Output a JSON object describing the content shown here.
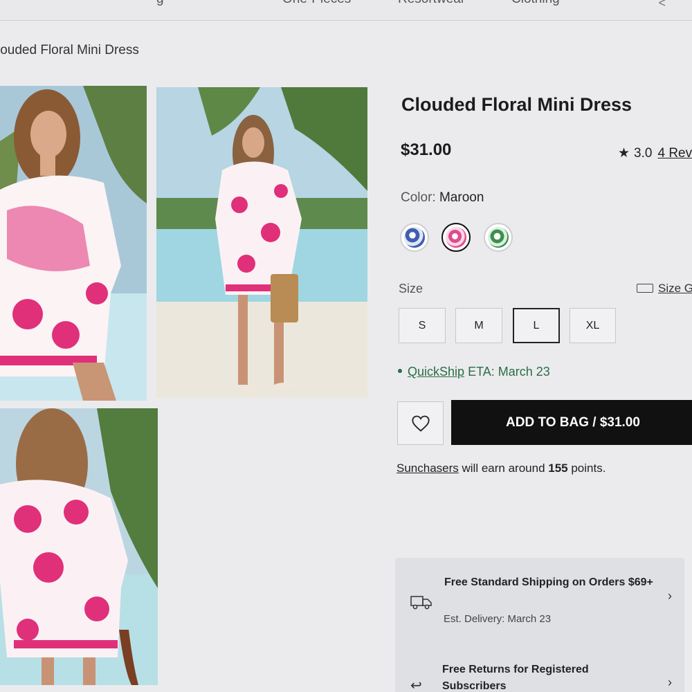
{
  "nav": {
    "items": [
      "g",
      "One-Pieces",
      "Resortwear",
      "Clothing"
    ],
    "chevron": "<"
  },
  "breadcrumb": "louded Floral Mini Dress",
  "product": {
    "title": "Clouded Floral Mini Dress",
    "price": "$31.00",
    "rating_star": "★",
    "rating": "3.0",
    "reviews": "4 Rev",
    "color_label": "Color:",
    "color_value": "Maroon",
    "swatches": [
      {
        "name": "blue floral",
        "color": "#3f5fb0",
        "selected": false
      },
      {
        "name": "maroon floral",
        "color": "#e04b8e",
        "selected": true
      },
      {
        "name": "green floral",
        "color": "#3d8f4f",
        "selected": false
      }
    ],
    "size_label": "Size",
    "size_guide": "Size G",
    "sizes": [
      "S",
      "M",
      "L",
      "XL"
    ],
    "selected_size": "L",
    "quickship_link": "QuickShip",
    "quickship_eta": "ETA: March 23",
    "add_to_bag": "ADD TO BAG / $31.00",
    "points_brand": "Sunchasers",
    "points_mid": " will earn around ",
    "points_num": "155",
    "points_end": " points."
  },
  "shipping": {
    "title": "Free Standard Shipping on Orders $69+",
    "sub": "Est. Delivery: March 23",
    "chevron": "›"
  },
  "returns": {
    "title": "Free Returns for Registered Subscribers",
    "chevron": "›",
    "icon": "↩"
  },
  "colors": {
    "accent_green": "#2a6e44",
    "button_black": "#111111",
    "dress_pink": "#e0307a"
  }
}
